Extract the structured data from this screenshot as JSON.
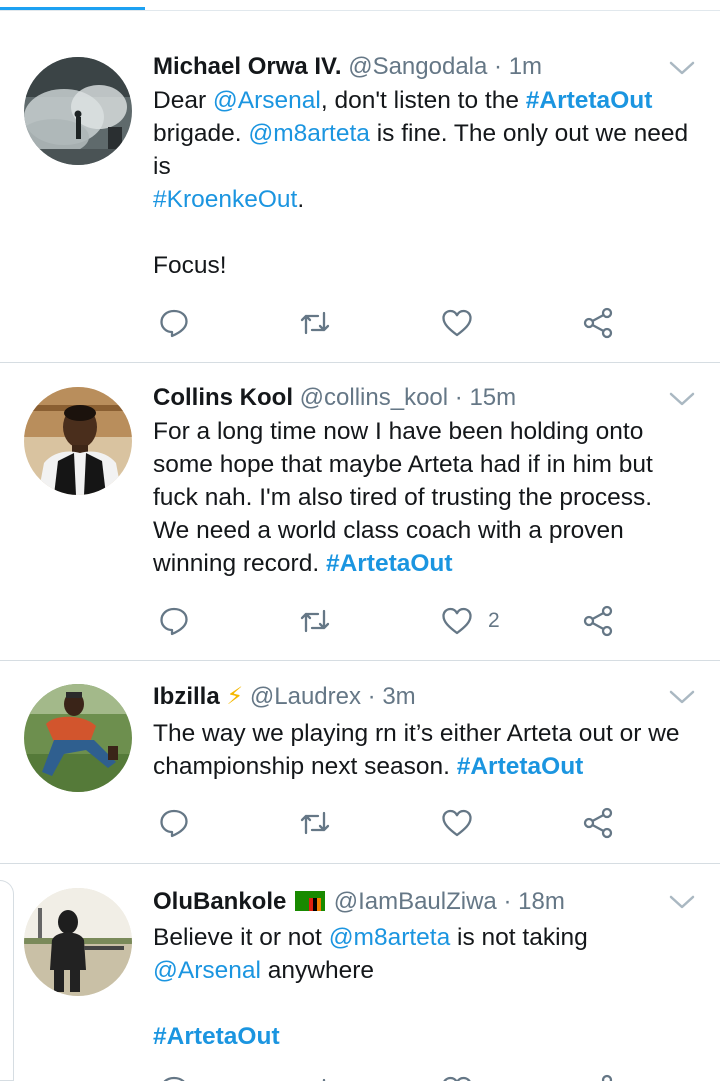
{
  "colors": {
    "accent": "#1b95e0",
    "muted": "#657786",
    "text": "#14171a",
    "divider": "#d6dde2"
  },
  "tweets": [
    {
      "name": "Michael Orwa IV.",
      "handle": "@Sangodala",
      "dot": "·",
      "time": "1m",
      "avatar": "avatar-riot-smoke",
      "lines": [
        [
          "Dear ",
          "@Arsenal",
          ", don't listen to the ",
          "#ArtetaOut"
        ],
        [
          "brigade. ",
          "@m8arteta",
          " is fine. The only out we need"
        ],
        [
          "is"
        ],
        [
          "#KroenkeOut",
          "."
        ],
        [
          ""
        ],
        [
          "Focus!"
        ]
      ],
      "likes": ""
    },
    {
      "name": "Collins Kool",
      "handle": "@collins_kool",
      "dot": "·",
      "time": "15m",
      "avatar": "avatar-man-black-vest",
      "lines": [
        [
          "For a long time now I have been holding onto"
        ],
        [
          "some hope that maybe Arteta had if in him but"
        ],
        [
          "fuck nah. I'm also tired of trusting the process."
        ],
        [
          "We need a world class coach with a proven"
        ],
        [
          "winning record. ",
          "#ArtetaOut"
        ]
      ],
      "likes": "2"
    },
    {
      "name": "Ibzilla",
      "emoji": "⚡",
      "handle": "@Laudrex",
      "dot": "·",
      "time": "3m",
      "avatar": "avatar-man-on-grass",
      "lines": [
        [
          "The way we playing rn it’s either Arteta out or we"
        ],
        [
          "championship next season. ",
          "#ArtetaOut"
        ]
      ],
      "likes": ""
    },
    {
      "name": "OluBankole",
      "emoji": "zambia-flag",
      "handle": "@IamBaulZiwa",
      "dot": "·",
      "time": "18m",
      "avatar": "avatar-man-hoodie-outdoor",
      "lines": [
        [
          "Believe it or not ",
          "@m8arteta",
          " is not taking"
        ],
        [
          "@Arsenal",
          " anywhere"
        ],
        [
          ""
        ],
        [
          "#ArtetaOut"
        ]
      ],
      "likes": ""
    }
  ],
  "icons": {
    "reply": "reply-icon",
    "retweet": "retweet-icon",
    "like": "heart-icon",
    "share": "share-icon",
    "menu": "chevron-down-icon"
  }
}
